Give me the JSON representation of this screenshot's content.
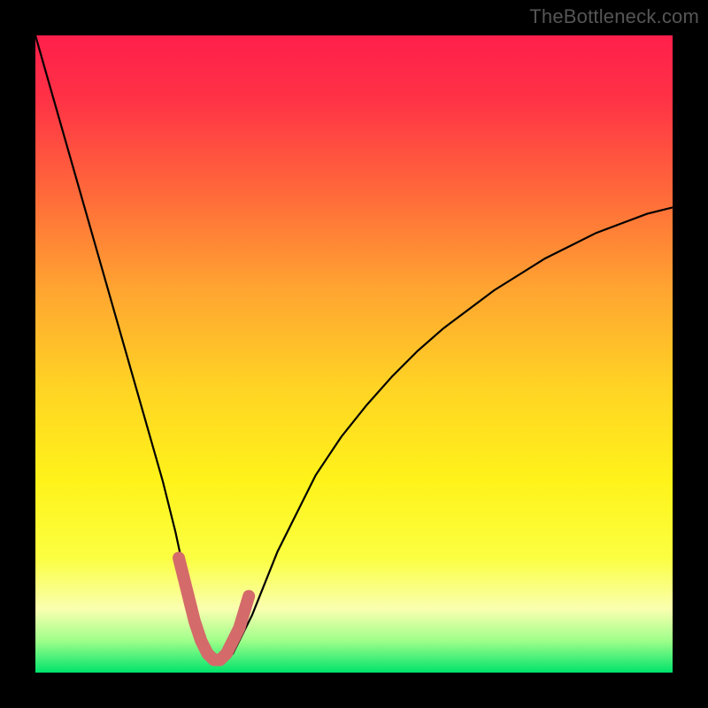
{
  "watermark": "TheBottleneck.com",
  "colors": {
    "frame": "#000000",
    "watermark": "#555555",
    "curve": "#000000",
    "highlight": "#d46a6a",
    "gradient_stops": [
      {
        "offset": 0.0,
        "color": "#ff1f4b"
      },
      {
        "offset": 0.1,
        "color": "#ff3246"
      },
      {
        "offset": 0.25,
        "color": "#ff6a3a"
      },
      {
        "offset": 0.4,
        "color": "#ffa531"
      },
      {
        "offset": 0.55,
        "color": "#ffd324"
      },
      {
        "offset": 0.7,
        "color": "#fff31a"
      },
      {
        "offset": 0.82,
        "color": "#fbff41"
      },
      {
        "offset": 0.9,
        "color": "#faffb0"
      },
      {
        "offset": 0.95,
        "color": "#9fff8a"
      },
      {
        "offset": 1.0,
        "color": "#00e36b"
      }
    ]
  },
  "chart_data": {
    "type": "line",
    "title": "",
    "xlabel": "",
    "ylabel": "",
    "xlim": [
      0,
      100
    ],
    "ylim": [
      0,
      100
    ],
    "grid": false,
    "series": [
      {
        "name": "bottleneck-curve",
        "x": [
          0,
          2,
          4,
          6,
          8,
          10,
          12,
          14,
          16,
          18,
          20,
          22,
          23.5,
          25,
          26,
          27,
          28,
          29,
          30,
          31,
          32,
          34,
          36,
          38,
          40,
          44,
          48,
          52,
          56,
          60,
          64,
          68,
          72,
          76,
          80,
          84,
          88,
          92,
          96,
          100
        ],
        "y": [
          100,
          93,
          86,
          79,
          72,
          65,
          58,
          51,
          44,
          37,
          30,
          22,
          15,
          10,
          6,
          3,
          2,
          1.5,
          2,
          3,
          5,
          9,
          14,
          19,
          23,
          31,
          37,
          42,
          46.5,
          50.5,
          54,
          57,
          60,
          62.5,
          65,
          67,
          69,
          70.5,
          72,
          73
        ]
      }
    ],
    "highlight": {
      "name": "trough-highlight",
      "x": [
        22.5,
        24,
        25,
        26,
        27,
        28,
        29,
        30,
        31,
        32,
        33.5
      ],
      "y": [
        18,
        12,
        8,
        5,
        3,
        2,
        2,
        3,
        5,
        7,
        12
      ]
    }
  }
}
